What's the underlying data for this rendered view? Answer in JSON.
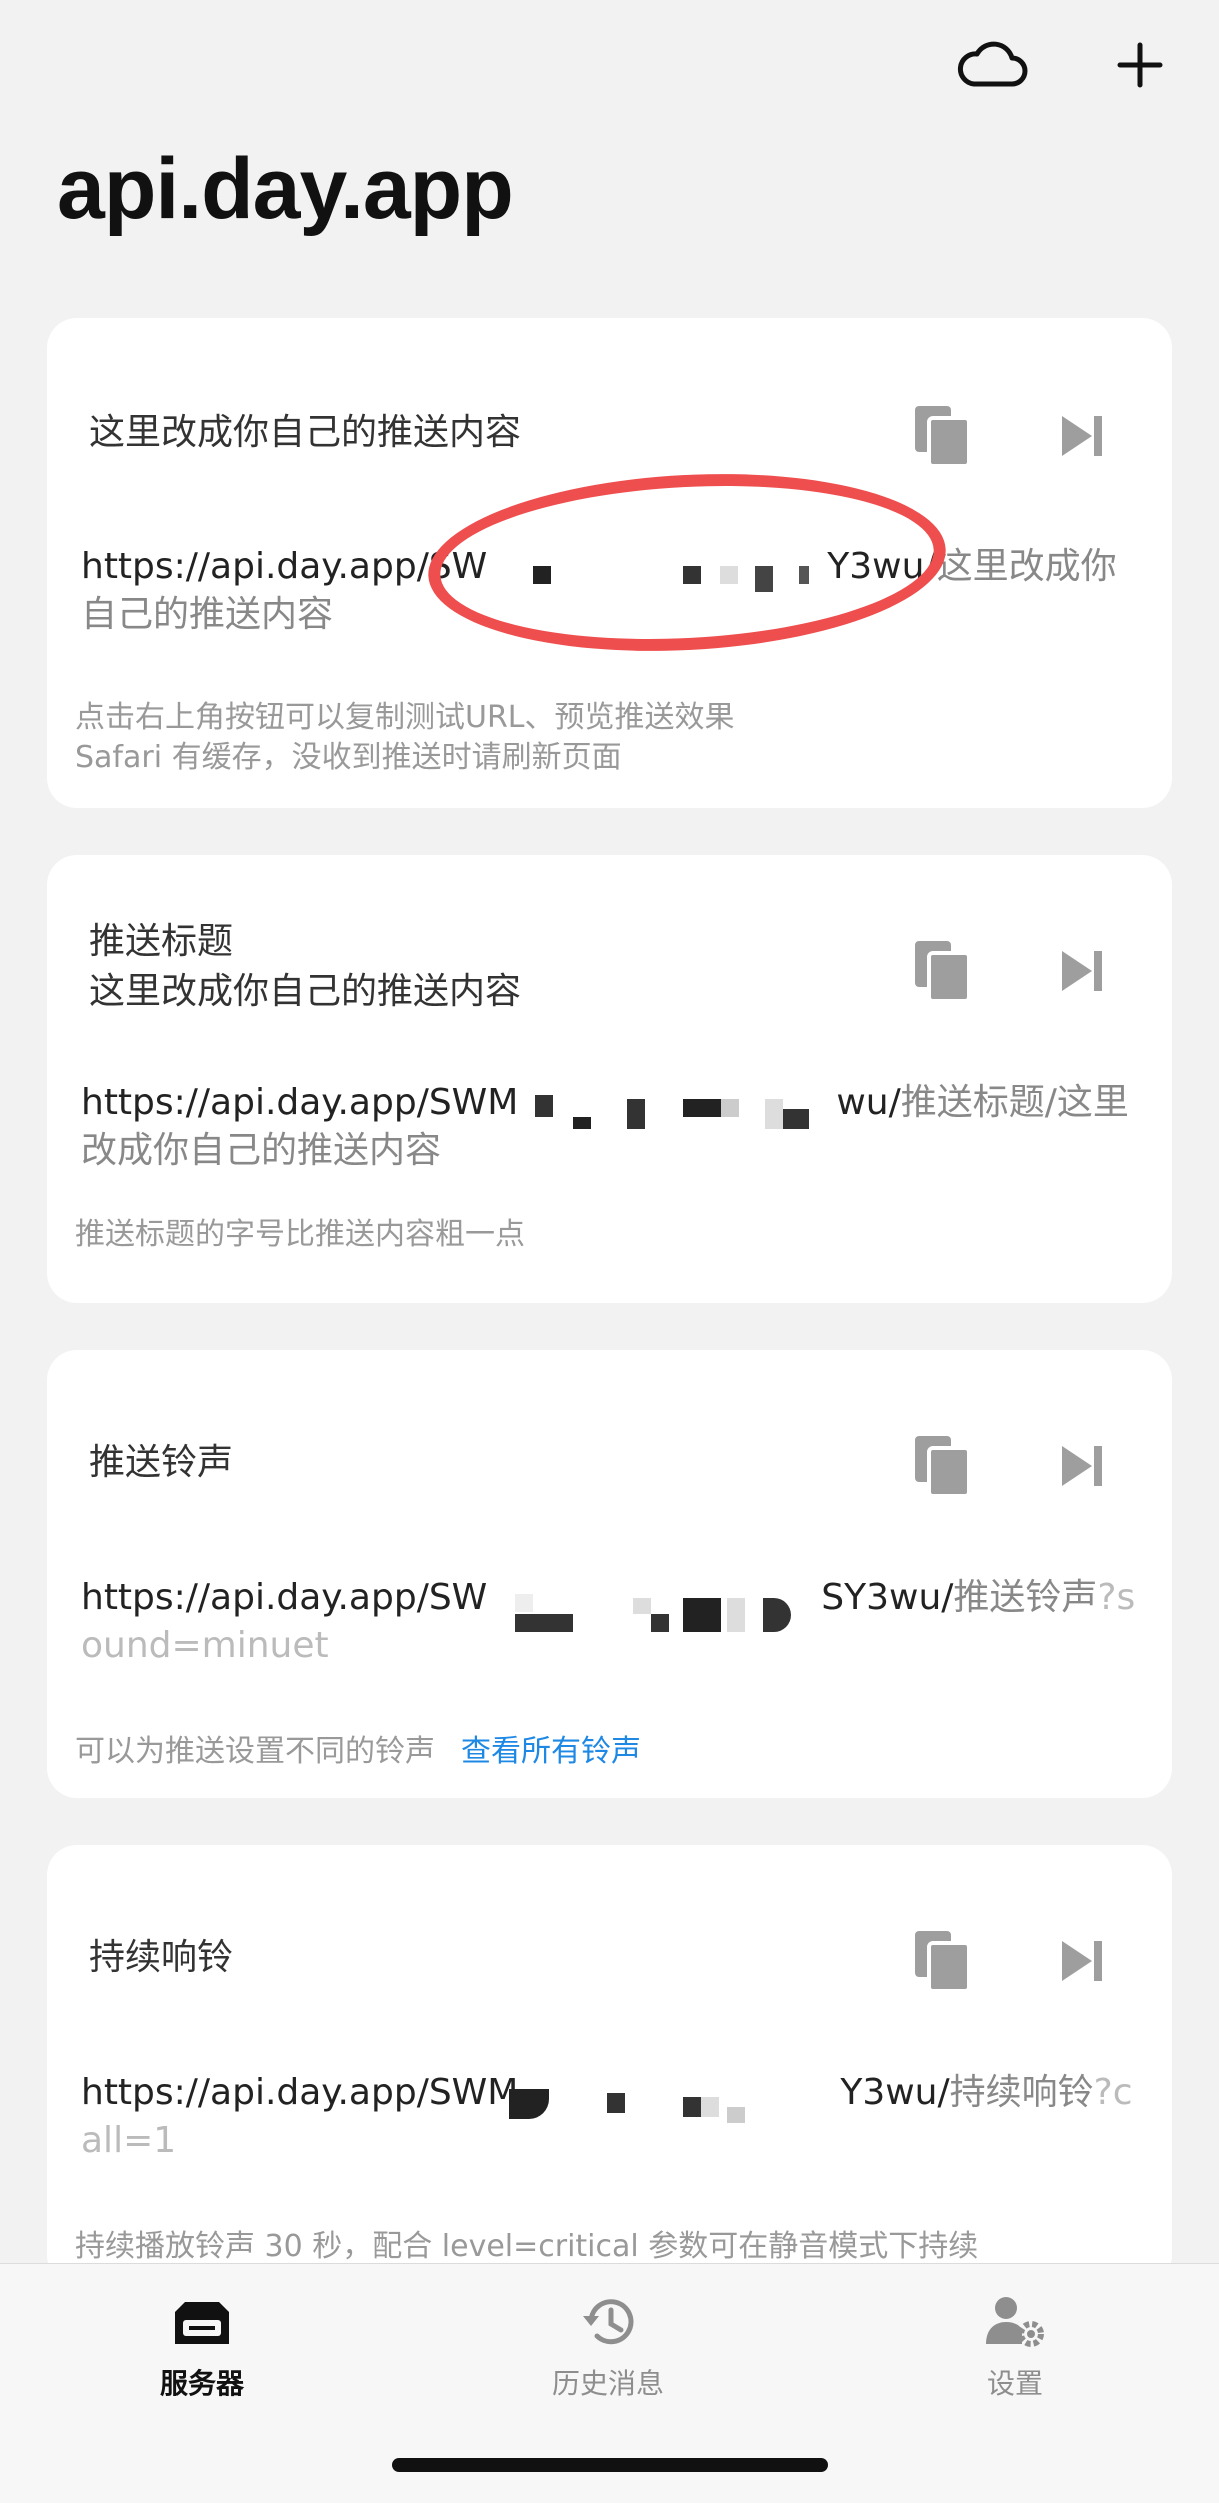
{
  "header": {
    "title": "api.day.app",
    "cloud_icon": "cloud-icon",
    "add_icon": "plus-icon"
  },
  "cards": [
    {
      "title": "这里改成你自己的推送内容",
      "title_line2": "",
      "url_base": "https://api.day.app/SW",
      "url_key_tail": "Y3wu/",
      "url_path": "这里改成你自己的推送内容",
      "url_query": "",
      "note_line1": "点击右上角按钮可以复制测试URL、预览推送效果",
      "note_line2": "Safari 有缓存，没收到推送时请刷新页面",
      "note_link": ""
    },
    {
      "title": "推送标题",
      "title_line2": "这里改成你自己的推送内容",
      "url_base": "https://api.day.app/SWM",
      "url_key_tail": "wu/",
      "url_path": "推送标题/这里改成你自己的推送内容",
      "url_query": "",
      "note_line1": "推送标题的字号比推送内容粗一点",
      "note_line2": "",
      "note_link": ""
    },
    {
      "title": "推送铃声",
      "title_line2": "",
      "url_base": "https://api.day.app/SW",
      "url_key_tail": "SY3wu/",
      "url_path": "推送铃声",
      "url_query": "?sound=minuet",
      "note_line1": "可以为推送设置不同的铃声",
      "note_line2": "",
      "note_link": "查看所有铃声"
    },
    {
      "title": "持续响铃",
      "title_line2": "",
      "url_base": "https://api.day.app/SWM",
      "url_key_tail": "Y3wu/",
      "url_path": "持续响铃",
      "url_query": "?call=1",
      "note_line1": "持续播放铃声 30 秒，配合 level=critical 参数可在静音模式下持续",
      "note_line2": "",
      "note_link": ""
    }
  ],
  "tabs": [
    {
      "label": "服务器",
      "icon": "server-icon",
      "active": true
    },
    {
      "label": "历史消息",
      "icon": "history-icon",
      "active": false
    },
    {
      "label": "设置",
      "icon": "settings-icon",
      "active": false
    }
  ],
  "colors": {
    "background": "#f2f2f2",
    "card": "#ffffff",
    "link": "#1e88e5",
    "annotation": "#ef4e4e",
    "icon_gray": "#9e9e9e"
  }
}
